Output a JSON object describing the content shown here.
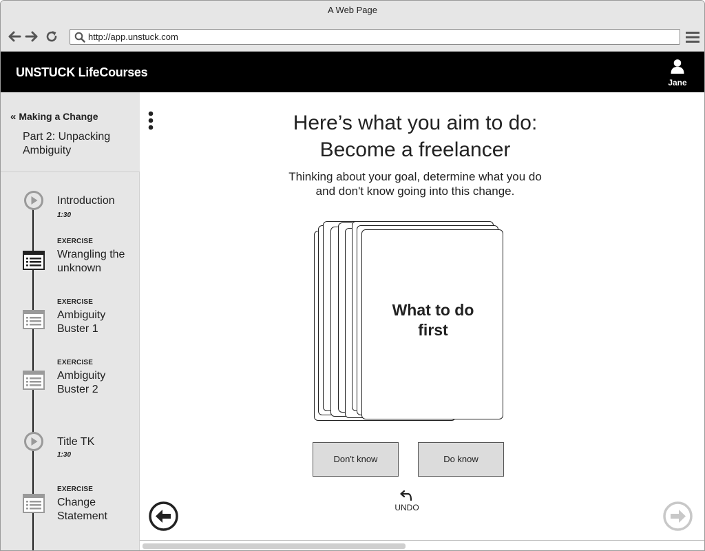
{
  "window": {
    "title": "A Web Page"
  },
  "browser": {
    "url": "http://app.unstuck.com"
  },
  "header": {
    "brand": "UNSTUCK LifeCourses",
    "user_name": "Jane"
  },
  "sidebar": {
    "back_label": "Making a Change",
    "part_title": "Part 2: Unpacking Ambiguity",
    "steps": [
      {
        "type": "video",
        "kicker": "",
        "title": "Introduction",
        "time": "1:30",
        "icon": "play-icon",
        "active": false
      },
      {
        "type": "exercise",
        "kicker": "EXERCISE",
        "title": "Wrangling the unknown",
        "time": "",
        "icon": "exercise-icon",
        "active": true
      },
      {
        "type": "exercise",
        "kicker": "EXERCISE",
        "title": "Ambiguity Buster 1",
        "time": "",
        "icon": "exercise-icon",
        "active": false
      },
      {
        "type": "exercise",
        "kicker": "EXERCISE",
        "title": "Ambiguity Buster 2",
        "time": "",
        "icon": "exercise-icon",
        "active": false
      },
      {
        "type": "video",
        "kicker": "",
        "title": "Title TK",
        "time": "1:30",
        "icon": "play-icon",
        "active": false
      },
      {
        "type": "exercise",
        "kicker": "EXERCISE",
        "title": "Change Statement",
        "time": "",
        "icon": "exercise-icon",
        "active": false
      }
    ]
  },
  "main": {
    "headline_line1": "Here’s what you aim to do:",
    "headline_line2": "Become a freelancer",
    "subline_line1": "Thinking about your goal, determine what you do",
    "subline_line2": "and don't know going into this change.",
    "card_text": "What to do first",
    "dont_know_label": "Don't know",
    "do_know_label": "Do know",
    "undo_label": "UNDO"
  },
  "colors": {
    "header_bg": "#000000",
    "sidebar_bg": "#e6e6e6",
    "button_bg": "#dcdcdc",
    "inactive_icon": "#9a9a9a"
  }
}
